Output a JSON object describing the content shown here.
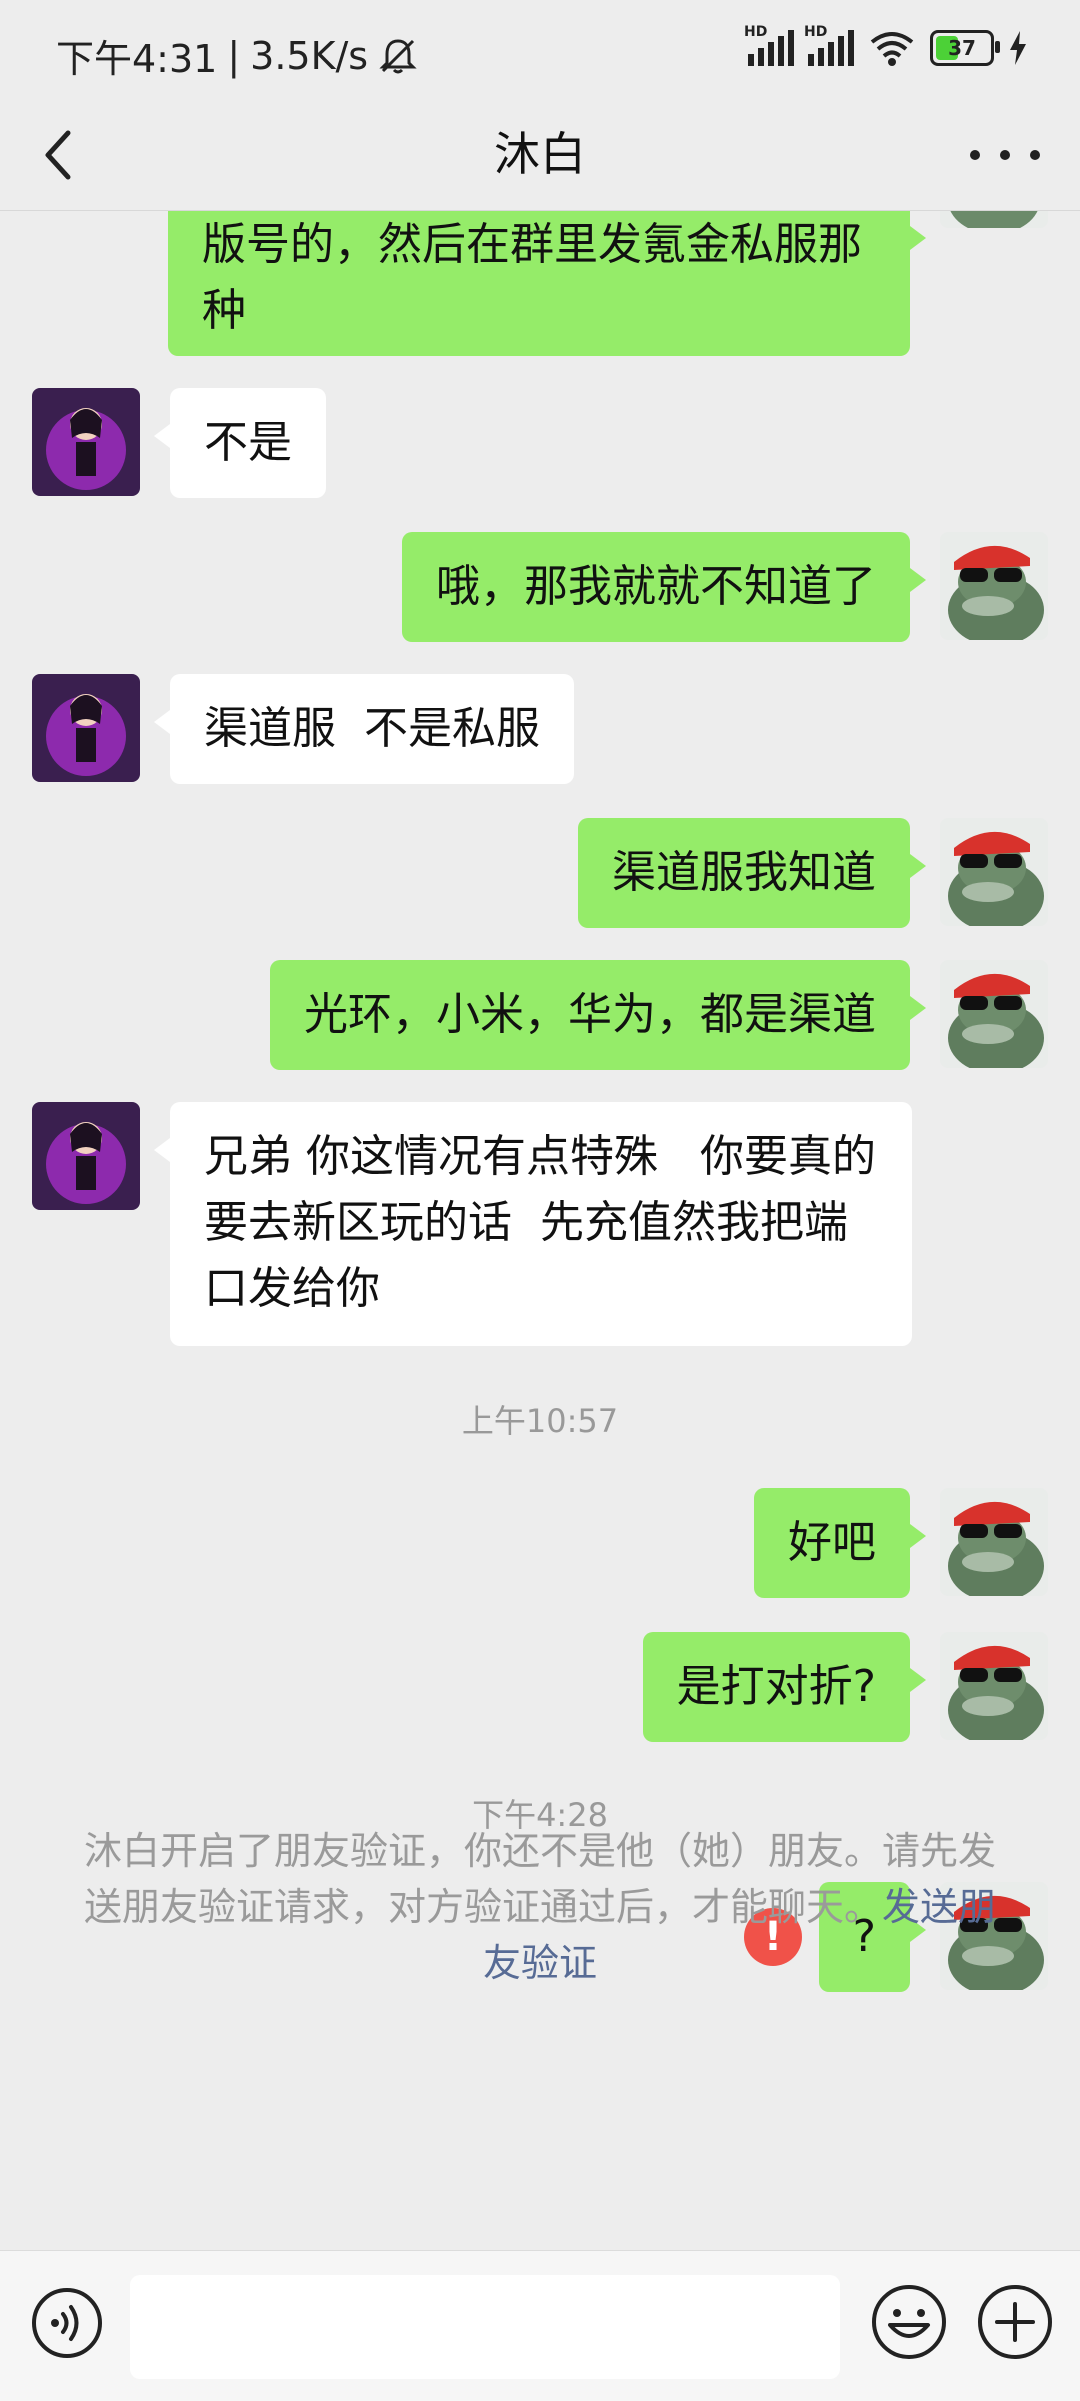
{
  "status_bar": {
    "time": "下午4:31",
    "net_speed": "3.5K/s",
    "signal_label_1": "HD",
    "signal_label_2": "HD",
    "battery": "37"
  },
  "header": {
    "title": "沐白"
  },
  "messages": [
    {
      "side": "me",
      "text": "版号的，然后在群里发氪金私服那\n种"
    },
    {
      "side": "other",
      "text": "不是"
    },
    {
      "side": "me",
      "text": "哦，那我就就不知道了"
    },
    {
      "side": "other",
      "text": "渠道服  不是私服"
    },
    {
      "side": "me",
      "text": "渠道服我知道"
    },
    {
      "side": "me",
      "text": "光环，小米，华为，都是渠道"
    },
    {
      "side": "other",
      "text": "兄弟 你这情况有点特殊   你要真的\n要去新区玩的话  先充值然我把端\n口发给你"
    },
    {
      "side": "me",
      "text": "好吧"
    },
    {
      "side": "me",
      "text": "是打对折?"
    },
    {
      "side": "me",
      "text": "?",
      "failed": true
    }
  ],
  "timestamps": [
    "上午10:57",
    "下午4:28"
  ],
  "error_mark": "!",
  "notice": {
    "text": "沐白开启了朋友验证，你还不是他（她）朋友。请先发送朋友验证请求，对方验证通过后，才能聊天。",
    "link": "发送朋友验证"
  },
  "colors": {
    "my_bubble": "#95ec69",
    "other_bubble": "#ffffff",
    "background": "#ededed",
    "error": "#f05249",
    "link": "#576b95"
  },
  "icons": [
    "back-arrow",
    "more-dots",
    "voice",
    "emoji",
    "plus",
    "alert",
    "mute-bell",
    "wifi",
    "battery",
    "charging-bolt"
  ]
}
